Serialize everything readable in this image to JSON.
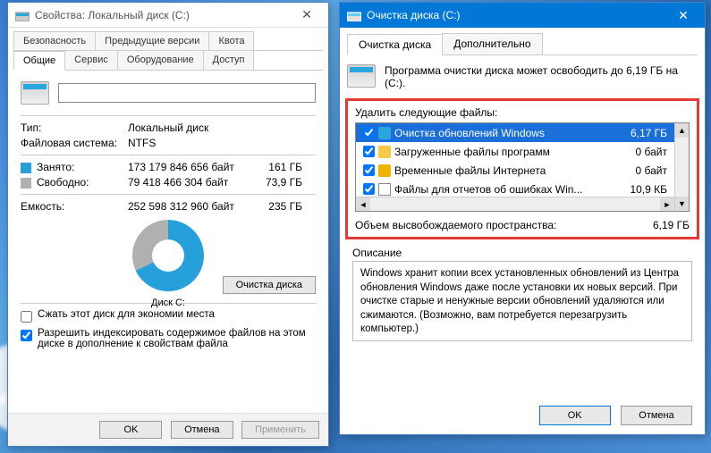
{
  "properties": {
    "title": "Свойства: Локальный диск (C:)",
    "tabs_row1": [
      "Безопасность",
      "Предыдущие версии",
      "Квота"
    ],
    "tabs_row2": [
      "Общие",
      "Сервис",
      "Оборудование",
      "Доступ"
    ],
    "active_tab": "Общие",
    "type_label": "Тип:",
    "type_value": "Локальный диск",
    "fs_label": "Файловая система:",
    "fs_value": "NTFS",
    "used_label": "Занято:",
    "used_bytes": "173 179 846 656 байт",
    "used_h": "161 ГБ",
    "free_label": "Свободно:",
    "free_bytes": "79 418 466 304 байт",
    "free_h": "73,9 ГБ",
    "cap_label": "Емкость:",
    "cap_bytes": "252 598 312 960 байт",
    "cap_h": "235 ГБ",
    "donut_label": "Диск C:",
    "cleanup_btn": "Очистка диска",
    "compress_label": "Сжать этот диск для экономии места",
    "compress_checked": false,
    "index_label": "Разрешить индексировать содержимое файлов на этом диске в дополнение к свойствам файла",
    "index_checked": true,
    "ok": "OK",
    "cancel": "Отмена",
    "apply": "Применить"
  },
  "cleanup": {
    "title": "Очистка диска  (C:)",
    "tabs": [
      "Очистка диска",
      "Дополнительно"
    ],
    "active_tab": "Очистка диска",
    "info_text": "Программа очистки диска может освободить до 6,19 ГБ на  (C:).",
    "delete_label": "Удалить следующие файлы:",
    "files": [
      {
        "checked": true,
        "icon": "win",
        "name": "Очистка обновлений Windows",
        "size": "6,17 ГБ",
        "selected": true
      },
      {
        "checked": true,
        "icon": "fold",
        "name": "Загруженные файлы программ",
        "size": "0 байт",
        "selected": false
      },
      {
        "checked": true,
        "icon": "lock",
        "name": "Временные файлы Интернета",
        "size": "0 байт",
        "selected": false
      },
      {
        "checked": true,
        "icon": "file",
        "name": "Файлы для отчетов об ошибках Win...",
        "size": "10,9 КБ",
        "selected": false
      }
    ],
    "freed_label": "Объем высвобождаемого пространства:",
    "freed_value": "6,19 ГБ",
    "desc_title": "Описание",
    "desc_text": "Windows хранит копии всех установленных обновлений из Центра обновления Windows даже после установки их новых версий. При очистке старые и ненужные версии обновлений удаляются или сжимаются. (Возможно, вам потребуется перезагрузить компьютер.)",
    "ok": "OK",
    "cancel": "Отмена"
  }
}
